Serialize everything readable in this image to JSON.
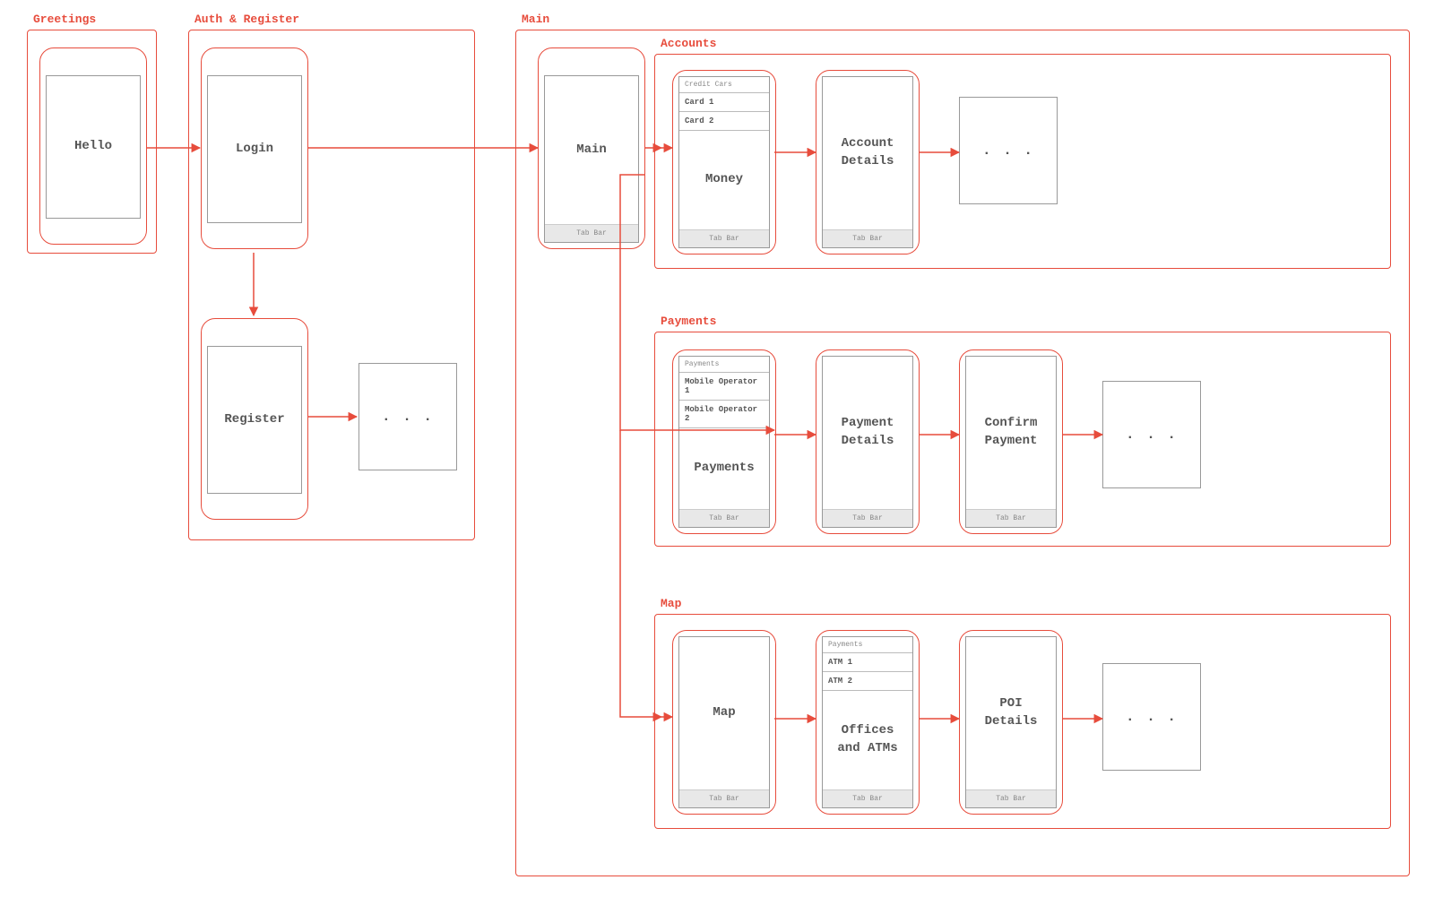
{
  "colors": {
    "accent": "#e74c3c",
    "line_gray": "#999999",
    "text_gray": "#555555"
  },
  "groups": {
    "greetings": {
      "label": "Greetings"
    },
    "auth": {
      "label": "Auth & Register"
    },
    "main_group": {
      "label": "Main"
    },
    "accounts": {
      "label": "Accounts"
    },
    "payments": {
      "label": "Payments"
    },
    "map": {
      "label": "Map"
    }
  },
  "screens": {
    "hello": {
      "title": "Hello"
    },
    "login": {
      "title": "Login"
    },
    "register": {
      "title": "Register"
    },
    "main": {
      "title": "Main",
      "tabbar": "Tab Bar"
    },
    "money": {
      "title": "Money",
      "list_header": "Credit Cars",
      "list_items": [
        "Card 1",
        "Card 2"
      ],
      "tabbar": "Tab Bar"
    },
    "account_details": {
      "title": "Account Details",
      "tabbar": "Tab Bar"
    },
    "payments_screen": {
      "title": "Payments",
      "list_header": "Payments",
      "list_items": [
        "Mobile Operator 1",
        "Mobile Operator 2"
      ],
      "tabbar": "Tab Bar"
    },
    "payment_details": {
      "title": "Payment Details",
      "tabbar": "Tab Bar"
    },
    "confirm_payment": {
      "title": "Confirm Payment",
      "tabbar": "Tab Bar"
    },
    "map_screen": {
      "title": "Map",
      "tabbar": "Tab Bar"
    },
    "offices": {
      "title": "Offices and ATMs",
      "list_header": "Payments",
      "list_items": [
        "ATM 1",
        "ATM 2"
      ],
      "tabbar": "Tab Bar"
    },
    "poi_details": {
      "title": "POI Details",
      "tabbar": "Tab Bar"
    }
  },
  "ellipsis": ". . ."
}
